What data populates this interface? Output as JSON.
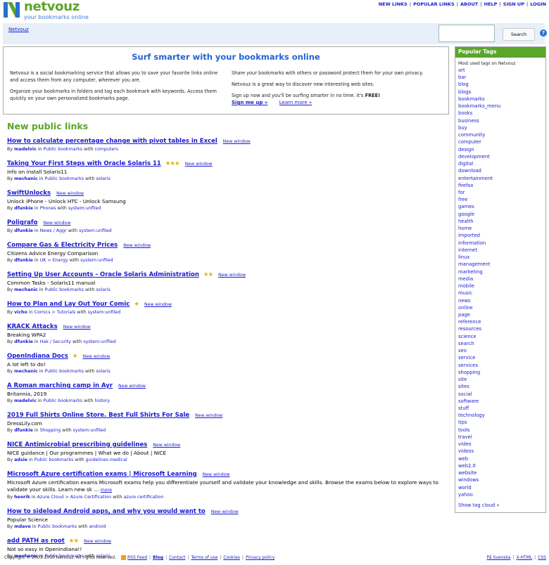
{
  "header": {
    "logo_name": "netvouz",
    "logo_tagline": "your bookmarks online",
    "nav": [
      "NEW LINKS",
      "POPULAR LINKS",
      "ABOUT",
      "HELP",
      "SIGN UP",
      "LOGIN"
    ]
  },
  "bar": {
    "breadcrumb": "Netvouz",
    "search_value": "",
    "search_button": "Search",
    "help_label": "?"
  },
  "intro": {
    "title": "Surf smarter with your bookmarks online",
    "left": [
      "Netvouz is a social bookmarking service that allows you to save your favorite links online and access them from any computer, wherever you are.",
      "Organize your bookmarks in folders and tag each bookmark with keywords. Access them quickly on your own personalized bookmarks page."
    ],
    "right": [
      "Share your bookmarks with others or password protect them for your own privacy.",
      "Netvouz is a great way to discover new interesting web sites.",
      "Sign up now and you'll be surfing smarter in no time. It's"
    ],
    "free_word": "FREE!",
    "signup_link": "Sign me up »",
    "learn_link": "Learn more »"
  },
  "links_section": {
    "title": "New public links",
    "new_window_label": "New window",
    "items": [
      {
        "title": "How to calculate percentage change with pivot tables in Excel",
        "stars": "",
        "desc": "",
        "user": "madelvic",
        "folder": "Public bookmarks",
        "tags": "computers"
      },
      {
        "title": "Taking Your First Steps with Oracle Solaris 11",
        "stars": "★★★",
        "desc": "Info on install Solaris11",
        "user": "mechanic",
        "folder": "Public bookmarks",
        "tags": "solaris"
      },
      {
        "title": "SwiftUnlocks",
        "stars": "",
        "desc": "Unlock iPhone - Unlock HTC - Unlock Samsung",
        "user": "dfunkie",
        "folder": "Phones",
        "tags": "system:unfiled"
      },
      {
        "title": "Poligrafo",
        "stars": "",
        "desc": "",
        "user": "dfunkie",
        "folder": "News / Aggr",
        "tags": "system:unfiled"
      },
      {
        "title": "Compare Gas & Electricity Prices",
        "stars": "",
        "desc": "Citizens Advice Energy Comparison",
        "user": "dfunkie",
        "folder": "UK > Energy",
        "tags": "system:unfiled"
      },
      {
        "title": "Setting Up User Accounts - Oracle Solaris Administration",
        "stars": "★★",
        "desc": "Common Tasks - Solaris11 manual",
        "user": "mechanic",
        "folder": "Public bookmarks",
        "tags": "solaris"
      },
      {
        "title": "How to Plan and Lay Out Your Comic",
        "stars": "★",
        "desc": "",
        "user": "vicho",
        "folder": "Comics > Tutorials",
        "tags": "system:unfiled"
      },
      {
        "title": "KRACK Attacks",
        "stars": "",
        "desc": "Breaking WPA2",
        "user": "dfunkie",
        "folder": "Hak / Security",
        "tags": "system:unfiled"
      },
      {
        "title": "OpenIndiana Docs",
        "stars": "★",
        "desc": "A lot left to do!",
        "user": "mechanic",
        "folder": "Public bookmarks",
        "tags": "solaris"
      },
      {
        "title": "A Roman marching camp in Ayr",
        "stars": "",
        "desc": "Britannia, 2019",
        "user": "madelvic",
        "folder": "Public bookmarks",
        "tags": "history"
      },
      {
        "title": "2019 Full Shirts Online Store. Best Full Shirts For Sale",
        "stars": "",
        "desc": "DressLily.com",
        "user": "dfunkie",
        "folder": "Shopping",
        "tags": "system:unfiled"
      },
      {
        "title": "NICE Antimicrobial prescribing guidelines",
        "stars": "",
        "desc": "NICE guidance | Our programmes | What we do | About | NICE",
        "user": "adsie",
        "folder": "Public bookmarks",
        "tags": "guidelines medical"
      },
      {
        "title": "Microsoft Azure certification exams | Microsoft Learning",
        "stars": "",
        "desc": "Microsoft Azure certification exams Microsoft exams help you differentiate yourself and validate your knowledge and skills. Browse the exams below to explore ways to validate your skills. Learn new sk ...",
        "more": "more",
        "user": "henrik",
        "folder": "Azure Cloud > Azure Certification",
        "tags": "azure certification"
      },
      {
        "title": "How to sideload Android apps, and why you would want to",
        "stars": "",
        "desc": "Popular Science",
        "user": "mdave",
        "folder": "Public bookmarks",
        "tags": "android"
      },
      {
        "title": "add PATH as root",
        "stars": "★★",
        "desc": "Not so easy in Openindiana!!",
        "user": "mechanic",
        "folder": "Public bookmarks",
        "tags": "solaris"
      }
    ],
    "by_word": "By",
    "in_word": "in",
    "with_word": "with"
  },
  "sidebar": {
    "title": "Popular Tags",
    "subtitle": "Most used tags on Netvouz",
    "tags": [
      "art",
      "bar",
      "blog",
      "blogs",
      "bookmarks",
      "bookmarks_menu",
      "books",
      "business",
      "buy",
      "community",
      "computer",
      "design",
      "development",
      "digital",
      "download",
      "entertainment",
      "firefox",
      "for",
      "free",
      "games",
      "google",
      "health",
      "home",
      "imported",
      "information",
      "internet",
      "linux",
      "management",
      "marketing",
      "media",
      "mobile",
      "music",
      "news",
      "online",
      "page",
      "reference",
      "resources",
      "science",
      "search",
      "seo",
      "service",
      "services",
      "shopping",
      "site",
      "sites",
      "social",
      "software",
      "stuff",
      "technology",
      "tips",
      "tools",
      "travel",
      "video",
      "videos",
      "web",
      "web2.0",
      "website",
      "windows",
      "world",
      "yahoo"
    ],
    "show_cloud": "Show tag cloud »"
  },
  "footer": {
    "copyright": "Copyright © 2003-2010 Netvouz. All rights reserved.",
    "links": [
      "RSS Feed",
      "Blog",
      "Contact",
      "Terms of use",
      "Cookies",
      "Privacy policy"
    ],
    "right_links": [
      "På Svenska",
      "X-HTML",
      "CSS"
    ]
  },
  "colors": {
    "brand_green": "#5aa52a",
    "link_blue": "#1a1ad0",
    "title_blue": "#1f63d6",
    "bar_bg": "#e7eff8",
    "star": "#e4b000"
  }
}
